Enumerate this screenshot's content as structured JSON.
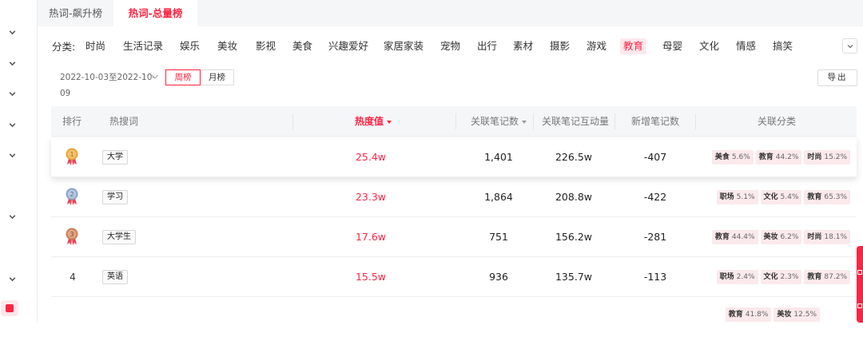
{
  "tabs": [
    {
      "label": "热词-飙升榜"
    },
    {
      "label": "热词-总量榜"
    }
  ],
  "categories": {
    "label": "分类:",
    "items": [
      "时尚",
      "生活记录",
      "娱乐",
      "美妆",
      "影视",
      "美食",
      "兴趣爱好",
      "家居家装",
      "宠物",
      "出行",
      "素材",
      "摄影",
      "游戏",
      "教育",
      "母婴",
      "文化",
      "情感",
      "搞笑"
    ],
    "active": "教育"
  },
  "date_range": "2022-10-03至2022-10-09",
  "period": {
    "week": "周榜",
    "month": "月榜"
  },
  "export_label": "导出",
  "table": {
    "headers": {
      "rank": "排行",
      "keyword": "热搜词",
      "heat": "热度值",
      "notes": "关联笔记数",
      "interactions": "关联笔记互动量",
      "new_notes": "新增笔记数",
      "categories": "关联分类"
    },
    "rows": [
      {
        "rank": "1",
        "keyword": "大学",
        "heat": "25.4w",
        "notes": "1,401",
        "interactions": "226.5w",
        "new_notes": "-407",
        "tags": [
          {
            "name": "美食",
            "pct": "5.6%"
          },
          {
            "name": "教育",
            "pct": "44.2%"
          },
          {
            "name": "时尚",
            "pct": "15.2%"
          }
        ]
      },
      {
        "rank": "2",
        "keyword": "学习",
        "heat": "23.3w",
        "notes": "1,864",
        "interactions": "208.8w",
        "new_notes": "-422",
        "tags": [
          {
            "name": "职场",
            "pct": "5.1%"
          },
          {
            "name": "文化",
            "pct": "5.4%"
          },
          {
            "name": "教育",
            "pct": "65.3%"
          }
        ]
      },
      {
        "rank": "3",
        "keyword": "大学生",
        "heat": "17.6w",
        "notes": "751",
        "interactions": "156.2w",
        "new_notes": "-281",
        "tags": [
          {
            "name": "教育",
            "pct": "44.4%"
          },
          {
            "name": "美妆",
            "pct": "6.2%"
          },
          {
            "name": "时尚",
            "pct": "18.1%"
          }
        ]
      },
      {
        "rank": "4",
        "keyword": "英语",
        "heat": "15.5w",
        "notes": "936",
        "interactions": "135.7w",
        "new_notes": "-113",
        "tags": [
          {
            "name": "职场",
            "pct": "2.4%"
          },
          {
            "name": "文化",
            "pct": "2.3%"
          },
          {
            "name": "教育",
            "pct": "87.2%"
          }
        ]
      },
      {
        "rank": "",
        "keyword": "",
        "heat": "",
        "notes": "",
        "interactions": "",
        "new_notes": "",
        "tags": [
          {
            "name": "教育",
            "pct": "41.8%"
          },
          {
            "name": "美妆",
            "pct": "12.5%"
          }
        ]
      }
    ]
  },
  "colors": {
    "accent": "#ff2442",
    "gold": "#e8a33d",
    "silver": "#8aa4c8",
    "bronze": "#c98058"
  }
}
